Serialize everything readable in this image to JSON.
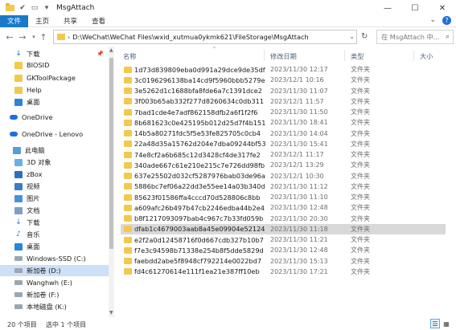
{
  "window": {
    "title": "MsgAttach",
    "controls": {
      "minimize": "—",
      "maximize": "☐",
      "close": "✕"
    }
  },
  "ribbon": {
    "tabs": [
      "文件",
      "主页",
      "共享",
      "查看"
    ],
    "active_tab": "文件",
    "accent_color": "#1979ca"
  },
  "navigation": {
    "address_path": "D:\\WeChat\\WeChat Files\\wxid_xutmua0ykmk621\\FileStorage\\MsgAttach",
    "search_placeholder": "在 MsgAttach 中..."
  },
  "sidebar": {
    "items": [
      {
        "label": "下载",
        "icon": "download-arrow-icon",
        "pinned": true
      },
      {
        "label": "BIOSID",
        "icon": "folder-icon"
      },
      {
        "label": "GKToolPackage",
        "icon": "folder-icon"
      },
      {
        "label": "Help",
        "icon": "folder-icon"
      },
      {
        "label": "桌面",
        "icon": "desktop-icon"
      },
      {
        "label": "OneDrive",
        "icon": "onedrive-icon"
      },
      {
        "label": "OneDrive - Lenovo",
        "icon": "onedrive-icon"
      },
      {
        "label": "此电脑",
        "icon": "computer-icon"
      },
      {
        "label": "3D 对象",
        "icon": "3d-objects-icon"
      },
      {
        "label": "zBox",
        "icon": "zbox-icon"
      },
      {
        "label": "视频",
        "icon": "video-icon"
      },
      {
        "label": "图片",
        "icon": "pictures-icon"
      },
      {
        "label": "文档",
        "icon": "documents-icon"
      },
      {
        "label": "下载",
        "icon": "download-arrow-icon"
      },
      {
        "label": "音乐",
        "icon": "music-icon"
      },
      {
        "label": "桌面",
        "icon": "desktop-icon"
      },
      {
        "label": "Windows-SSD (C:)",
        "icon": "drive-icon"
      },
      {
        "label": "新加卷 (D:)",
        "icon": "drive-icon",
        "selected": true
      },
      {
        "label": "Wanghwh (E:)",
        "icon": "drive-icon"
      },
      {
        "label": "新加卷 (F:)",
        "icon": "drive-icon"
      },
      {
        "label": "本地磁盘 (K:)",
        "icon": "drive-icon"
      }
    ]
  },
  "columns": {
    "name": "名称",
    "date": "修改日期",
    "type": "类型",
    "size": "大小"
  },
  "files": [
    {
      "name": "1d73d839809eba0d991a29dce9de35df",
      "date": "2023/11/30 12:17",
      "type": "文件夹"
    },
    {
      "name": "3c0196296138ba14cd9f5960bbb5279e",
      "date": "2023/12/1 10:16",
      "type": "文件夹"
    },
    {
      "name": "3e5262d1c1688bfa8fde6a7c1391dce2",
      "date": "2023/11/30 11:07",
      "type": "文件夹"
    },
    {
      "name": "3f003b65ab332f277d8260634c0db311",
      "date": "2023/12/1 11:57",
      "type": "文件夹"
    },
    {
      "name": "7bad1cde4e7adf862158dfb2a6f1f2f6",
      "date": "2023/11/30 11:50",
      "type": "文件夹"
    },
    {
      "name": "8b681623c0e425195b012d25d7f4b151",
      "date": "2023/11/30 18:41",
      "type": "文件夹"
    },
    {
      "name": "14b5a80271fdc5f5e53fe825705c0cb4",
      "date": "2023/11/30 14:04",
      "type": "文件夹"
    },
    {
      "name": "22a48d35a15762d204e7dba09244bf53",
      "date": "2023/11/30 15:41",
      "type": "文件夹"
    },
    {
      "name": "74e8cf2a6b685c12d3428cf4de317fe2",
      "date": "2023/12/1 11:17",
      "type": "文件夹"
    },
    {
      "name": "340ade667c61e210e215c7e726dd98fb",
      "date": "2023/12/1 13:29",
      "type": "文件夹"
    },
    {
      "name": "637e25502d032cf5287976bab03de96a",
      "date": "2023/12/1 10:30",
      "type": "文件夹"
    },
    {
      "name": "5886bc7ef06a22dd3e55ee14a03b340d",
      "date": "2023/11/30 11:12",
      "type": "文件夹"
    },
    {
      "name": "85623f01586ffa4cccd70d528806c8bb",
      "date": "2023/11/30 11:10",
      "type": "文件夹"
    },
    {
      "name": "a609afc26b497b47cb2246edba44b2e4",
      "date": "2023/11/30 12:48",
      "type": "文件夹"
    },
    {
      "name": "b8f1217093097bab4c967c7b33fd059b",
      "date": "2023/11/30 20:30",
      "type": "文件夹"
    },
    {
      "name": "dfab1c4679003aab8a45e09904e52124",
      "date": "2023/11/30 11:18",
      "type": "文件夹",
      "selected": true
    },
    {
      "name": "e2f2a0d12458716f0d667cdb327b10b7",
      "date": "2023/11/30 11:21",
      "type": "文件夹"
    },
    {
      "name": "f7e3c94598b71338e254b8f5dde5829d",
      "date": "2023/11/30 12:48",
      "type": "文件夹"
    },
    {
      "name": "faebdd2abe5f8948cf792214e0022bd7",
      "date": "2023/11/30 15:13",
      "type": "文件夹"
    },
    {
      "name": "fd4c61270614e111f1ea21e387ff10eb",
      "date": "2023/11/30 17:21",
      "type": "文件夹"
    }
  ],
  "status": {
    "item_count": "20 个项目",
    "selected": "选中 1 个项目"
  }
}
